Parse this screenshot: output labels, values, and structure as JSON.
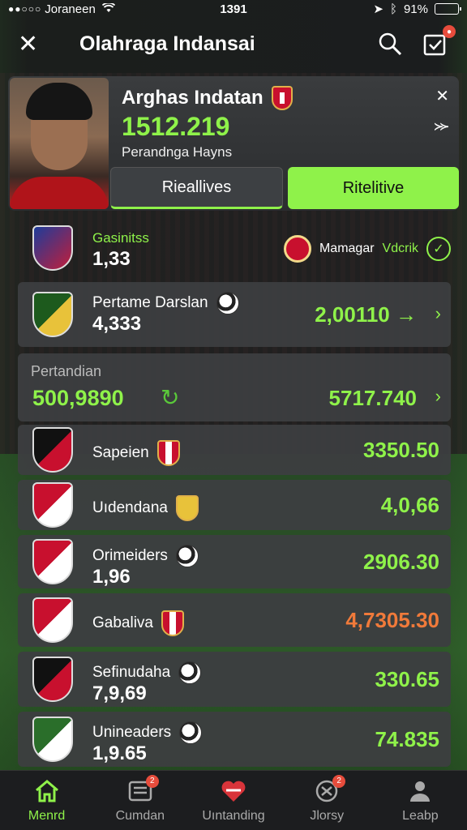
{
  "status_bar": {
    "carrier": "Joraneen",
    "time": "1391",
    "battery": "91%",
    "battery_level": 0.91
  },
  "nav": {
    "title": "Olahraga Indansai",
    "notification_count": ""
  },
  "profile": {
    "name": "Arghas Indatan",
    "value": "1512.219",
    "subtitle": "Perandnga Hayns",
    "segment_left": "Rieallives",
    "segment_right": "Ritelitive"
  },
  "summary": {
    "label": "Gasinitss",
    "number": "1,33",
    "manager_label": "Mamagar",
    "manager_name": "Vdcrik"
  },
  "rows": [
    {
      "name": "Pertame Darslan",
      "sub": "4,333",
      "value": "2,00110 →",
      "value_color": "#8ff24a",
      "chevron": "›",
      "crest_colors": [
        "#1d5a1d",
        "#e8c23a"
      ],
      "icon": "ball"
    },
    {
      "name": "Pertandian",
      "sub": "500,9890",
      "value": "5717.740",
      "value_color": "#8ff24a",
      "chevron": "›",
      "icon": "arrow"
    },
    {
      "name": "Sapeien",
      "sub": "",
      "value": "3350.50",
      "value_color": "#8ff24a",
      "chevron": "",
      "crest_colors": [
        "#111",
        "#c8102e"
      ],
      "icon": "crest"
    },
    {
      "name": "Uıdendana",
      "sub": "",
      "value": "4,0,66",
      "value_color": "#8ff24a",
      "chevron": "",
      "crest_colors": [
        "#c8102e",
        "#fff"
      ],
      "icon": "yellow-crest"
    },
    {
      "name": "Orimeiders",
      "sub": "1,96",
      "value": "2906.30",
      "value_color": "#8ff24a",
      "chevron": "",
      "crest_colors": [
        "#c8102e",
        "#fff"
      ],
      "icon": "ball"
    },
    {
      "name": "Gabaliva",
      "sub": "",
      "value": "4,7305.30",
      "value_color": "#f07a3a",
      "chevron": "",
      "crest_colors": [
        "#c8102e",
        "#fff"
      ],
      "icon": "crest"
    },
    {
      "name": "Sefinudaha",
      "sub": "7,9,69",
      "value": "330.65",
      "value_color": "#8ff24a",
      "chevron": "",
      "crest_colors": [
        "#111",
        "#c8102e"
      ],
      "icon": "ball"
    },
    {
      "name": "Unineaders",
      "sub": "1,9.65",
      "value": "74.835",
      "value_color": "#8ff24a",
      "chevron": "",
      "crest_colors": [
        "#2a6e2a",
        "#fff"
      ],
      "icon": "ball"
    }
  ],
  "tabs": [
    {
      "label": "Menrd",
      "icon": "home-icon",
      "active": true,
      "badge": ""
    },
    {
      "label": "Cumdan",
      "icon": "list-icon",
      "active": false,
      "badge": "2"
    },
    {
      "label": "Uıntanding",
      "icon": "heart-icon",
      "active": false,
      "badge": ""
    },
    {
      "label": "Jlorsy",
      "icon": "jersey-icon",
      "active": false,
      "badge": "2"
    },
    {
      "label": "Leabp",
      "icon": "person-icon",
      "active": false,
      "badge": ""
    }
  ]
}
